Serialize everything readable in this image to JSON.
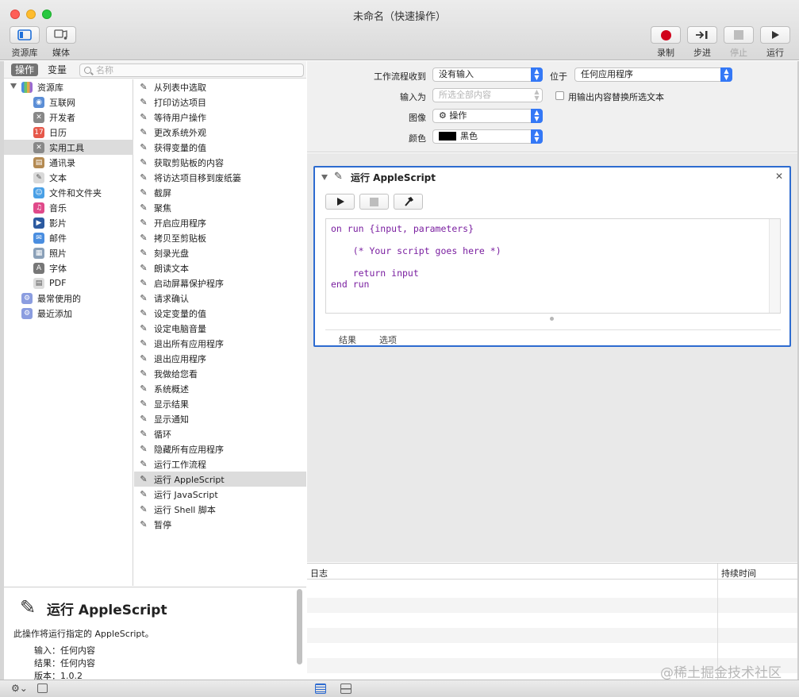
{
  "window": {
    "title": "未命名（快速操作）"
  },
  "toolbar": {
    "library": "资源库",
    "media": "媒体",
    "record": "录制",
    "step": "步进",
    "stop": "停止",
    "run": "运行"
  },
  "left_tabs": {
    "actions": "操作",
    "variables": "变量",
    "search_placeholder": "名称"
  },
  "library": {
    "root": "资源库",
    "items": [
      {
        "label": "互联网",
        "icon": "globe-icon",
        "color": "#5b8ed6"
      },
      {
        "label": "开发者",
        "icon": "tools-icon",
        "color": "#888888"
      },
      {
        "label": "日历",
        "icon": "calendar-icon",
        "color": "#e6584a"
      },
      {
        "label": "实用工具",
        "icon": "tools-icon",
        "color": "#888888"
      },
      {
        "label": "通讯录",
        "icon": "contacts-icon",
        "color": "#b48a52"
      },
      {
        "label": "文本",
        "icon": "text-icon",
        "color": "#d9d9d9"
      },
      {
        "label": "文件和文件夹",
        "icon": "finder-icon",
        "color": "#4aa0e6"
      },
      {
        "label": "音乐",
        "icon": "music-icon",
        "color": "#e04a8a"
      },
      {
        "label": "影片",
        "icon": "movie-icon",
        "color": "#2c5aa0"
      },
      {
        "label": "邮件",
        "icon": "mail-icon",
        "color": "#4a8ee0"
      },
      {
        "label": "照片",
        "icon": "photo-icon",
        "color": "#8aa0b8"
      },
      {
        "label": "字体",
        "icon": "font-icon",
        "color": "#777777"
      },
      {
        "label": "PDF",
        "icon": "pdf-icon",
        "color": "#dddddd"
      }
    ],
    "extras": [
      {
        "label": "最常使用的"
      },
      {
        "label": "最近添加"
      }
    ]
  },
  "actions": [
    "从列表中选取",
    "打印访达项目",
    "等待用户操作",
    "更改系统外观",
    "获得变量的值",
    "获取剪贴板的内容",
    "将访达项目移到废纸篓",
    "截屏",
    "聚焦",
    "开启应用程序",
    "拷贝至剪贴板",
    "刻录光盘",
    "朗读文本",
    "启动屏幕保护程序",
    "请求确认",
    "设定变量的值",
    "设定电脑音量",
    "退出所有应用程序",
    "退出应用程序",
    "我做给您看",
    "系统概述",
    "显示结果",
    "显示通知",
    "循环",
    "隐藏所有应用程序",
    "运行工作流程",
    "运行 AppleScript",
    "运行 JavaScript",
    "运行 Shell 脚本",
    "暂停"
  ],
  "description": {
    "title": "运行 AppleScript",
    "text": "此操作将运行指定的 AppleScript。",
    "input_label": "输入：",
    "input_value": "任何内容",
    "result_label": "结果：",
    "result_value": "任何内容",
    "version_label": "版本：",
    "version_value": "1.0.2"
  },
  "settings": {
    "receives_label": "工作流程收到",
    "receives_value": "没有输入",
    "in_label": "位于",
    "in_value": "任何应用程序",
    "input_is_label": "输入为",
    "input_is_value": "所选全部内容",
    "replace_label": "用输出内容替换所选文本",
    "image_label": "图像",
    "image_value": "操作",
    "color_label": "颜色",
    "color_value": "黑色"
  },
  "action_box": {
    "title": "运行 AppleScript",
    "code_lines": [
      "on run {input, parameters}",
      "",
      "    (* Your script goes here *)",
      "",
      "    return input",
      "end run"
    ],
    "tab_results": "结果",
    "tab_options": "选项"
  },
  "log": {
    "col_log": "日志",
    "col_duration": "持续时间"
  },
  "watermark": "@稀土掘金技术社区",
  "colors": {
    "accent": "#3478f6",
    "selection": "#dcdcdc",
    "record": "#d0021b"
  }
}
